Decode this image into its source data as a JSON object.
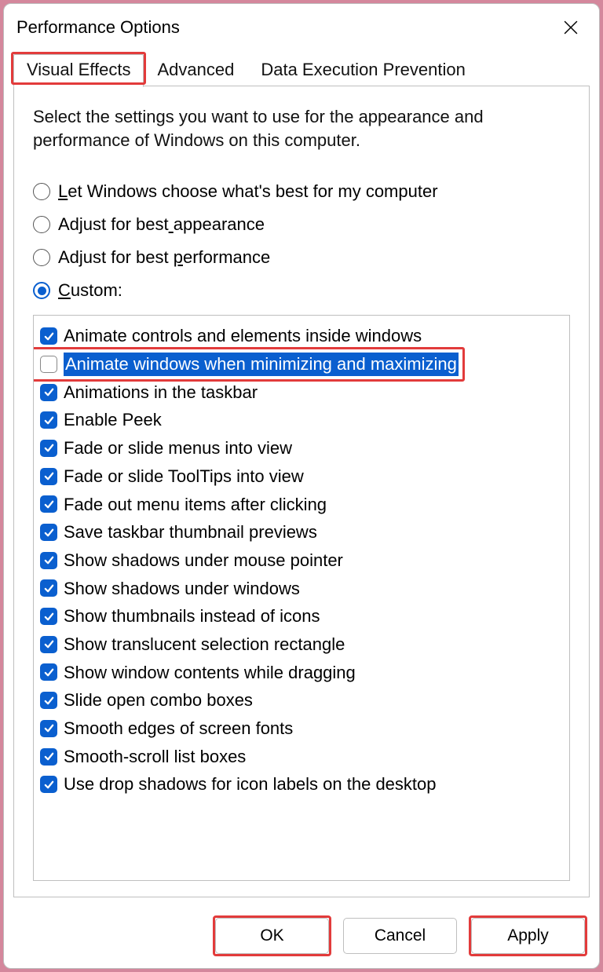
{
  "window": {
    "title": "Performance Options"
  },
  "tabs": [
    {
      "label": "Visual Effects",
      "active": true,
      "highlighted": true
    },
    {
      "label": "Advanced",
      "active": false,
      "highlighted": false
    },
    {
      "label": "Data Execution Prevention",
      "active": false,
      "highlighted": false
    }
  ],
  "intro": "Select the settings you want to use for the appearance and performance of Windows on this computer.",
  "radios": [
    {
      "label": "Let Windows choose what's best for my computer",
      "underline_index": 0,
      "selected": false
    },
    {
      "label": "Adjust for best appearance",
      "underline_index": 15,
      "selected": false
    },
    {
      "label": "Adjust for best performance",
      "underline_index": 16,
      "selected": false
    },
    {
      "label": "Custom:",
      "underline_index": 0,
      "selected": true
    }
  ],
  "checks": [
    {
      "label": "Animate controls and elements inside windows",
      "checked": true,
      "selected": false,
      "highlighted": false
    },
    {
      "label": "Animate windows when minimizing and maximizing",
      "checked": false,
      "selected": true,
      "highlighted": true
    },
    {
      "label": "Animations in the taskbar",
      "checked": true,
      "selected": false,
      "highlighted": false
    },
    {
      "label": "Enable Peek",
      "checked": true,
      "selected": false,
      "highlighted": false
    },
    {
      "label": "Fade or slide menus into view",
      "checked": true,
      "selected": false,
      "highlighted": false
    },
    {
      "label": "Fade or slide ToolTips into view",
      "checked": true,
      "selected": false,
      "highlighted": false
    },
    {
      "label": "Fade out menu items after clicking",
      "checked": true,
      "selected": false,
      "highlighted": false
    },
    {
      "label": "Save taskbar thumbnail previews",
      "checked": true,
      "selected": false,
      "highlighted": false
    },
    {
      "label": "Show shadows under mouse pointer",
      "checked": true,
      "selected": false,
      "highlighted": false
    },
    {
      "label": "Show shadows under windows",
      "checked": true,
      "selected": false,
      "highlighted": false
    },
    {
      "label": "Show thumbnails instead of icons",
      "checked": true,
      "selected": false,
      "highlighted": false
    },
    {
      "label": "Show translucent selection rectangle",
      "checked": true,
      "selected": false,
      "highlighted": false
    },
    {
      "label": "Show window contents while dragging",
      "checked": true,
      "selected": false,
      "highlighted": false
    },
    {
      "label": "Slide open combo boxes",
      "checked": true,
      "selected": false,
      "highlighted": false
    },
    {
      "label": "Smooth edges of screen fonts",
      "checked": true,
      "selected": false,
      "highlighted": false
    },
    {
      "label": "Smooth-scroll list boxes",
      "checked": true,
      "selected": false,
      "highlighted": false
    },
    {
      "label": "Use drop shadows for icon labels on the desktop",
      "checked": true,
      "selected": false,
      "highlighted": false
    }
  ],
  "buttons": {
    "ok": "OK",
    "cancel": "Cancel",
    "apply": "Apply"
  },
  "button_highlights": {
    "ok": true,
    "cancel": false,
    "apply": true
  }
}
